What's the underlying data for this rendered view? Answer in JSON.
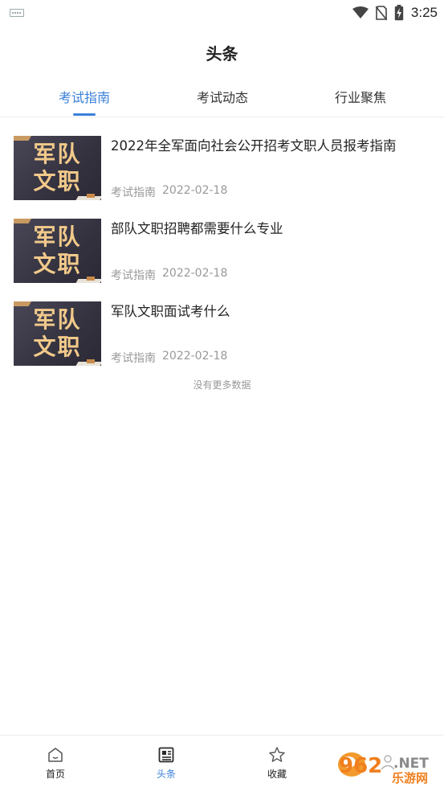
{
  "status_bar": {
    "time": "3:25",
    "icons": [
      "keyboard-icon",
      "wifi-icon",
      "no-sim-icon",
      "battery-charging-icon"
    ]
  },
  "header": {
    "title": "头条"
  },
  "tabs": [
    {
      "label": "考试指南",
      "active": true
    },
    {
      "label": "考试动态",
      "active": false
    },
    {
      "label": "行业聚焦",
      "active": false
    }
  ],
  "articles": [
    {
      "thumb_line1": "军队",
      "thumb_line2": "文职",
      "title": "2022年全军面向社会公开招考文职人员报考指南",
      "category": "考试指南",
      "date": "2022-02-18"
    },
    {
      "thumb_line1": "军队",
      "thumb_line2": "文职",
      "title": "部队文职招聘都需要什么专业",
      "category": "考试指南",
      "date": "2022-02-18"
    },
    {
      "thumb_line1": "军队",
      "thumb_line2": "文职",
      "title": "军队文职面试考什么",
      "category": "考试指南",
      "date": "2022-02-18"
    }
  ],
  "no_more_text": "没有更多数据",
  "bottom_nav": [
    {
      "label": "首页",
      "icon": "home-icon",
      "active": false
    },
    {
      "label": "头条",
      "icon": "news-icon",
      "active": true
    },
    {
      "label": "收藏",
      "icon": "star-icon",
      "active": false
    },
    {
      "label": "",
      "icon": "profile-icon",
      "active": false
    }
  ],
  "watermark": {
    "brand": "962",
    "suffix": "NET",
    "sub": "乐游网"
  },
  "colors": {
    "accent": "#3a7fd9",
    "text": "#222222",
    "muted": "#999999"
  }
}
